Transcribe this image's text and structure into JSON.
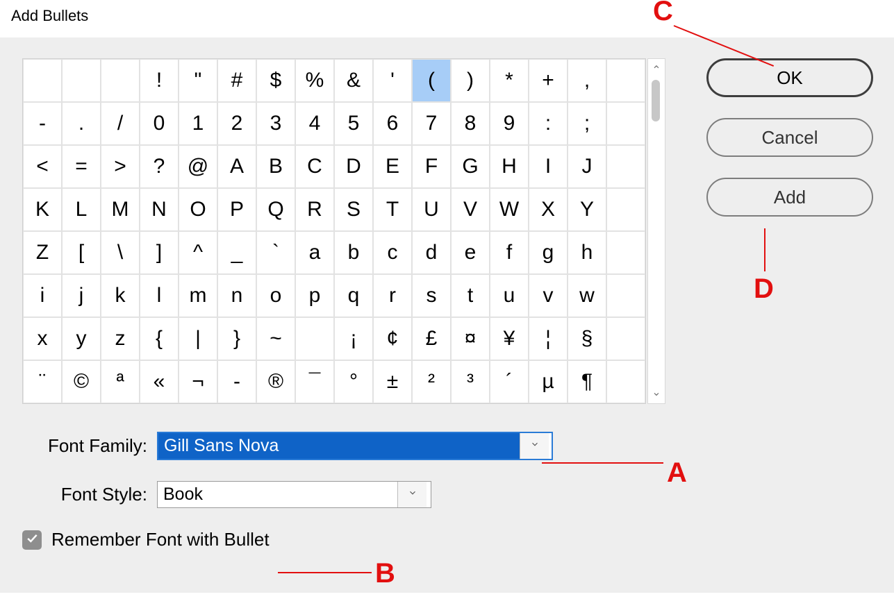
{
  "dialog": {
    "title": "Add Bullets"
  },
  "buttons": {
    "ok": "OK",
    "cancel": "Cancel",
    "add": "Add"
  },
  "grid": {
    "selected_index": 10,
    "chars": [
      "",
      "",
      "",
      "!",
      "\"",
      "#",
      "$",
      "%",
      "&",
      "'",
      "(",
      ")",
      "*",
      "+",
      ",",
      "",
      "-",
      ".",
      "/",
      "0",
      "1",
      "2",
      "3",
      "4",
      "5",
      "6",
      "7",
      "8",
      "9",
      ":",
      ";",
      "",
      "<",
      "=",
      ">",
      "?",
      "@",
      "A",
      "B",
      "C",
      "D",
      "E",
      "F",
      "G",
      "H",
      "I",
      "J",
      "",
      "K",
      "L",
      "M",
      "N",
      "O",
      "P",
      "Q",
      "R",
      "S",
      "T",
      "U",
      "V",
      "W",
      "X",
      "Y",
      "",
      "Z",
      "[",
      "\\",
      "]",
      "^",
      "_",
      "`",
      "a",
      "b",
      "c",
      "d",
      "e",
      "f",
      "g",
      "h",
      "",
      "i",
      "j",
      "k",
      "l",
      "m",
      "n",
      "o",
      "p",
      "q",
      "r",
      "s",
      "t",
      "u",
      "v",
      "w",
      "",
      "x",
      "y",
      "z",
      "{",
      "|",
      "}",
      "~",
      "",
      "¡",
      "¢",
      "£",
      "¤",
      "¥",
      "¦",
      "§",
      "",
      "¨",
      "©",
      "ª",
      "«",
      "¬",
      "-",
      "®",
      "¯",
      "°",
      "±",
      "²",
      "³",
      "´",
      "µ",
      "¶",
      ""
    ]
  },
  "fontFamily": {
    "label": "Font Family:",
    "value": "Gill Sans Nova"
  },
  "fontStyle": {
    "label": "Font Style:",
    "value": "Book"
  },
  "remember": {
    "checked": true,
    "label": "Remember Font with Bullet"
  },
  "annotations": {
    "a": "A",
    "b": "B",
    "c": "C",
    "d": "D"
  }
}
